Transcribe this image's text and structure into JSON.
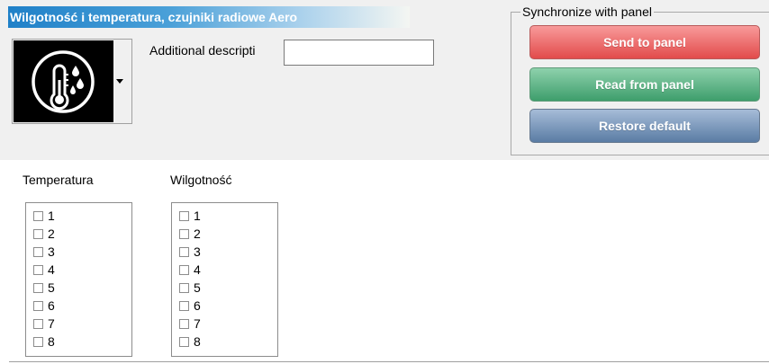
{
  "header": {
    "title": "Wilgotność i temperatura, czujniki radiowe Aero"
  },
  "device_icon": {
    "icon": "thermometer-humidity-icon",
    "colors": {
      "background": "#000000",
      "foreground": "#ffffff"
    }
  },
  "description": {
    "label": "Additional descripti",
    "value": ""
  },
  "sync": {
    "legend": "Synchronize with panel",
    "send_label": "Send to panel",
    "read_label": "Read from panel",
    "restore_label": "Restore default",
    "colors": {
      "send": "#e85a5a",
      "read": "#4caf7a",
      "restore": "#6a89b0"
    }
  },
  "temperature": {
    "header": "Temperatura",
    "items": [
      {
        "label": "1",
        "checked": false
      },
      {
        "label": "2",
        "checked": false
      },
      {
        "label": "3",
        "checked": false
      },
      {
        "label": "4",
        "checked": false
      },
      {
        "label": "5",
        "checked": false
      },
      {
        "label": "6",
        "checked": false
      },
      {
        "label": "7",
        "checked": false
      },
      {
        "label": "8",
        "checked": false
      }
    ]
  },
  "humidity": {
    "header": "Wilgotność",
    "items": [
      {
        "label": "1",
        "checked": false
      },
      {
        "label": "2",
        "checked": false
      },
      {
        "label": "3",
        "checked": false
      },
      {
        "label": "4",
        "checked": false
      },
      {
        "label": "5",
        "checked": false
      },
      {
        "label": "6",
        "checked": false
      },
      {
        "label": "7",
        "checked": false
      },
      {
        "label": "8",
        "checked": false
      }
    ]
  }
}
